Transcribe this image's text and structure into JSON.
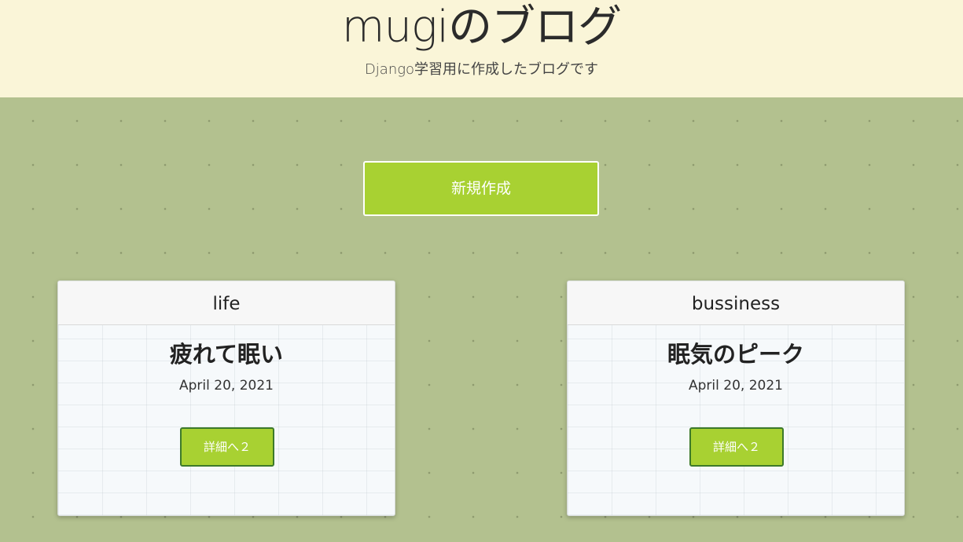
{
  "header": {
    "title": "mugiのブログ",
    "subtitle": "Django学習用に作成したブログです"
  },
  "actions": {
    "new_post_label": "新規作成"
  },
  "posts": [
    {
      "category": "life",
      "title": "疲れて眠い",
      "date": "April 20, 2021",
      "detail_label": "詳細へ２"
    },
    {
      "category": "bussiness",
      "title": "眠気のピーク",
      "date": "April 20, 2021",
      "detail_label": "詳細へ２"
    }
  ],
  "colors": {
    "header_bg": "#faf5d8",
    "main_bg": "#b3c18f",
    "accent_green": "#a8d132",
    "button_border": "#3d7a2a"
  }
}
